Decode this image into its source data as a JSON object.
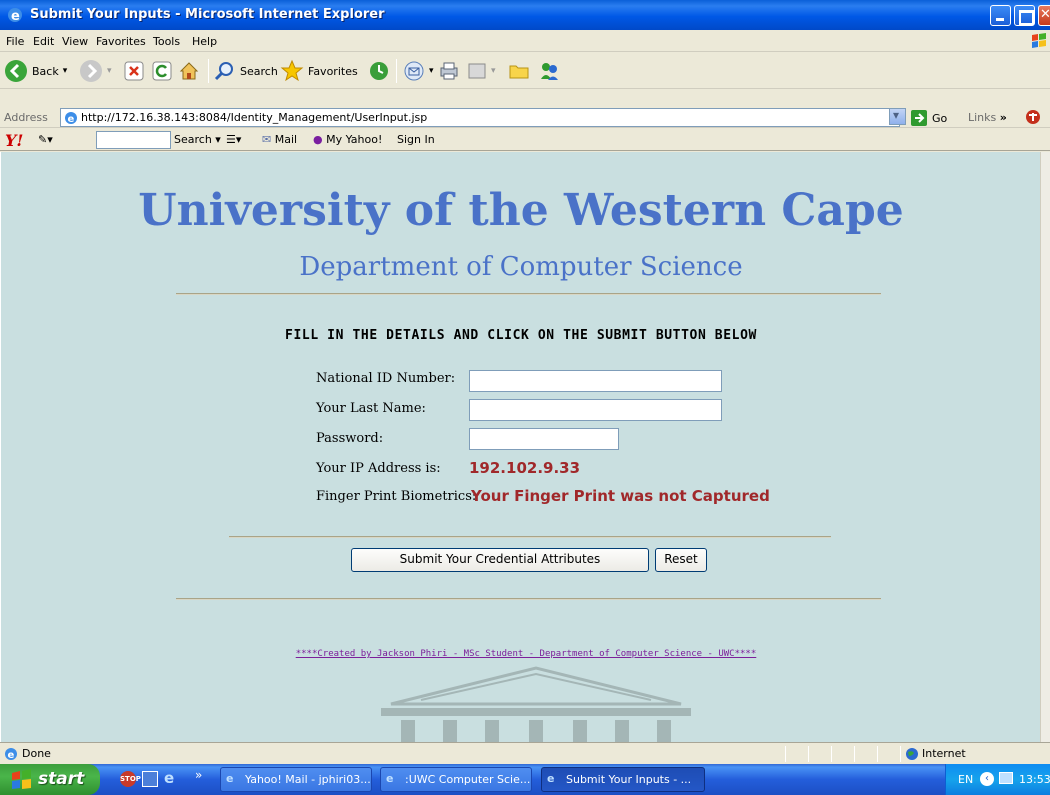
{
  "window": {
    "title": "Submit Your Inputs - Microsoft Internet Explorer"
  },
  "menu": [
    "File",
    "Edit",
    "View",
    "Favorites",
    "Tools",
    "Help"
  ],
  "toolbar": {
    "back": "Back",
    "search": "Search",
    "favorites": "Favorites"
  },
  "address": {
    "label": "Address",
    "url": "http://172.16.38.143:8084/Identity_Management/UserInput.jsp",
    "go": "Go",
    "links": "Links"
  },
  "yahoo": {
    "search": "Search",
    "mail": "Mail",
    "my_yahoo": "My Yahoo!",
    "sign_in": "Sign In"
  },
  "page": {
    "heading": "University of the Western Cape",
    "subheading": "Department of Computer Science",
    "instruction": "FILL IN THE DETAILS AND CLICK ON THE SUBMIT BUTTON BELOW",
    "fields": {
      "national_id_label": "National ID Number:",
      "last_name_label": "Your Last Name:",
      "password_label": "Password:",
      "ip_label": "Your IP Address is:",
      "ip_value": "192.102.9.33",
      "fingerprint_label": "Finger Print Biometrics:",
      "fingerprint_value": "Your Finger Print was not Captured"
    },
    "submit_label": "Submit Your Credential Attributes",
    "reset_label": "Reset",
    "credit": "****Created by Jackson Phiri - MSc Student - Department of Computer Science - UWC****"
  },
  "status": {
    "text": "Done",
    "zone": "Internet"
  },
  "taskbar": {
    "start": "start",
    "items": [
      "Yahoo! Mail - jphiri03...",
      ":UWC Computer Scie...",
      "Submit Your Inputs - ..."
    ],
    "lang": "EN",
    "clock": "13:53"
  },
  "colors": {
    "page_background": "#c9dfe0",
    "heading": "#4a72c8",
    "value_red": "#a0282a",
    "link_purple": "#7c1f9a"
  }
}
